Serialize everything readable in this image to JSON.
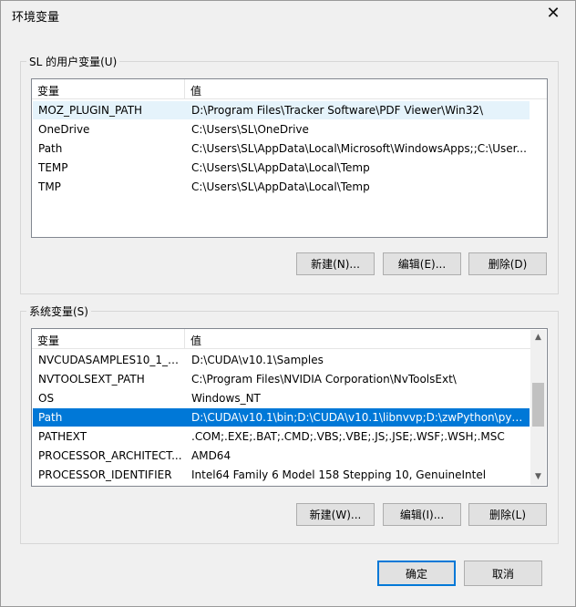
{
  "window": {
    "title": "环境变量",
    "close_glyph": "✕"
  },
  "user_vars": {
    "legend": "SL 的用户变量(U)",
    "col_name": "变量",
    "col_value": "值",
    "rows": [
      {
        "name": "MOZ_PLUGIN_PATH",
        "value": "D:\\Program Files\\Tracker Software\\PDF Viewer\\Win32\\"
      },
      {
        "name": "OneDrive",
        "value": "C:\\Users\\SL\\OneDrive"
      },
      {
        "name": "Path",
        "value": "C:\\Users\\SL\\AppData\\Local\\Microsoft\\WindowsApps;;C:\\User..."
      },
      {
        "name": "TEMP",
        "value": "C:\\Users\\SL\\AppData\\Local\\Temp"
      },
      {
        "name": "TMP",
        "value": "C:\\Users\\SL\\AppData\\Local\\Temp"
      }
    ],
    "buttons": {
      "new": "新建(N)...",
      "edit": "编辑(E)...",
      "delete": "删除(D)"
    }
  },
  "system_vars": {
    "legend": "系统变量(S)",
    "col_name": "变量",
    "col_value": "值",
    "rows": [
      {
        "name": "NVCUDASAMPLES10_1_R...",
        "value": "D:\\CUDA\\v10.1\\Samples"
      },
      {
        "name": "NVTOOLSEXT_PATH",
        "value": "C:\\Program Files\\NVIDIA Corporation\\NvToolsExt\\"
      },
      {
        "name": "OS",
        "value": "Windows_NT"
      },
      {
        "name": "Path",
        "value": "D:\\CUDA\\v10.1\\bin;D:\\CUDA\\v10.1\\libnvvp;D:\\zwPython\\py37\\..."
      },
      {
        "name": "PATHEXT",
        "value": ".COM;.EXE;.BAT;.CMD;.VBS;.VBE;.JS;.JSE;.WSF;.WSH;.MSC"
      },
      {
        "name": "PROCESSOR_ARCHITECT...",
        "value": "AMD64"
      },
      {
        "name": "PROCESSOR_IDENTIFIER",
        "value": "Intel64 Family 6 Model 158 Stepping 10, GenuineIntel"
      }
    ],
    "selected_row": 3,
    "buttons": {
      "new": "新建(W)...",
      "edit": "编辑(I)...",
      "delete": "删除(L)"
    }
  },
  "dialog_buttons": {
    "ok": "确定",
    "cancel": "取消"
  }
}
